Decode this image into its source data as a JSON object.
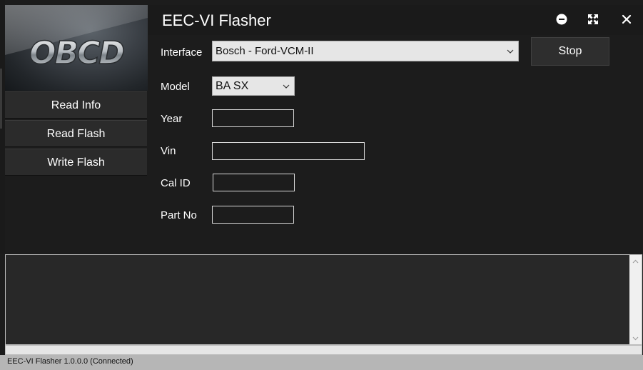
{
  "window": {
    "title": "EEC-VI Flasher",
    "controls": [
      "minimize-icon",
      "maximize-icon",
      "close-icon"
    ]
  },
  "logo": {
    "text": "OBCD"
  },
  "sidebar": {
    "items": [
      {
        "label": "Read Info"
      },
      {
        "label": "Read Flash"
      },
      {
        "label": "Write Flash"
      }
    ]
  },
  "form": {
    "interface": {
      "label": "Interface",
      "value": "Bosch - Ford-VCM-II"
    },
    "model": {
      "label": "Model",
      "value": "BA SX"
    },
    "year": {
      "label": "Year",
      "value": ""
    },
    "vin": {
      "label": "Vin",
      "value": ""
    },
    "cal_id": {
      "label": "Cal ID",
      "value": ""
    },
    "part_no": {
      "label": "Part No",
      "value": ""
    },
    "stop_label": "Stop"
  },
  "log": {
    "text": ""
  },
  "progress": {
    "value": 0
  },
  "status": {
    "text": "EEC-VI Flasher 1.0.0.0 (Connected)"
  },
  "colors": {
    "background": "#1c1c1c",
    "button": "#2b2b2b",
    "select_bg": "#e6e6e6",
    "statusbar": "#b6b6b6"
  }
}
